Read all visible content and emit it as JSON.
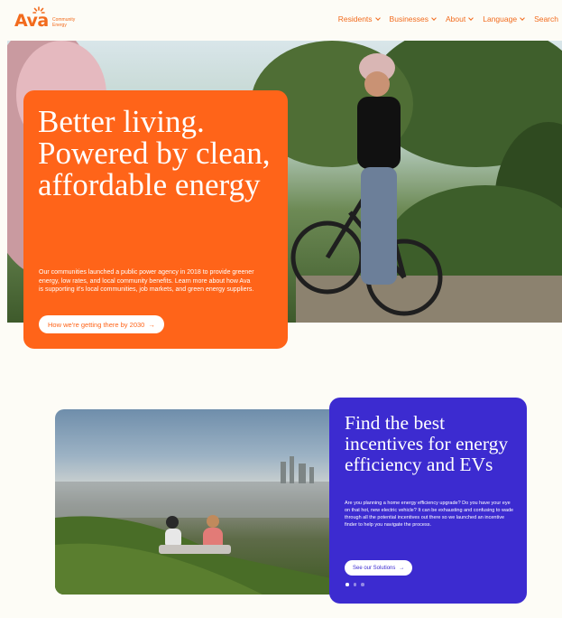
{
  "header": {
    "logo": {
      "word": "Ava",
      "sub_line1": "Community",
      "sub_line2": "Energy"
    },
    "nav": [
      {
        "label": "Residents",
        "has_dropdown": true
      },
      {
        "label": "Businesses",
        "has_dropdown": true
      },
      {
        "label": "About",
        "has_dropdown": true
      },
      {
        "label": "Language",
        "has_dropdown": true
      },
      {
        "label": "Search",
        "has_dropdown": false
      }
    ]
  },
  "hero": {
    "title": "Better living. Powered by clean, affordable energy",
    "body": "Our communities launched a public power agency in 2018 to provide greener energy, low rates, and local community benefits. Learn more about how Ava is supporting it's local communities, job markets, and green energy suppliers.",
    "button_label": "How we're getting there by 2030",
    "button_arrow": "→"
  },
  "incentives": {
    "title": "Find the best incentives for energy efficiency and EVs",
    "body": "Are you planning a home energy efficiency upgrade? Do you have your eye on that hot, new electric vehicle? It can be exhausting and confusing to wade through all the potential incentives out there so we launched an incentive finder to help you navigate the process.",
    "button_label": "See our Solutions",
    "button_arrow": "→",
    "carousel_active": 1,
    "carousel_count": 3
  },
  "colors": {
    "brand_orange": "#ff6419",
    "accent_blue": "#3c2bd0",
    "background": "#fdfcf6"
  },
  "icons": {
    "nav_chevron": "chevron-down-icon",
    "arrow": "arrow-right-icon",
    "logo_sun": "sun-icon"
  }
}
